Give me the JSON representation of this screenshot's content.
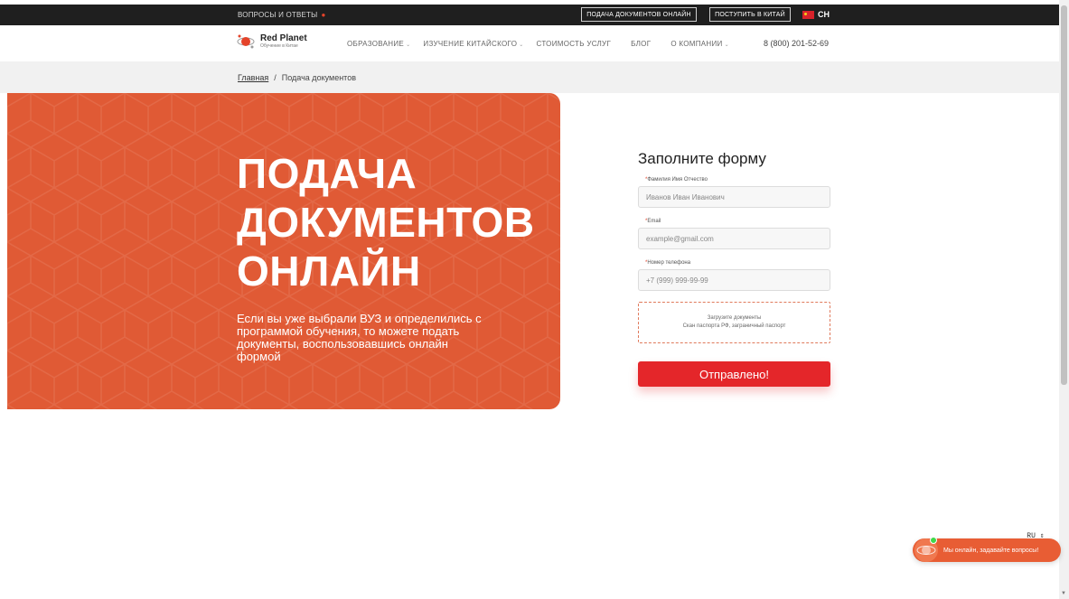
{
  "topbar": {
    "faq_label": "ВОПРОСЫ И ОТВЕТЫ",
    "submit_docs_button": "ПОДАЧА ДОКУМЕНТОВ ОНЛАЙН",
    "apply_china_button": "ПОСТУПИТЬ В КИТАЙ",
    "language": "CH"
  },
  "header": {
    "logo_name": "Red Planet",
    "logo_tagline": "Обучение в Китае",
    "nav": [
      {
        "label": "ОБРАЗОВАНИЕ",
        "dropdown": true
      },
      {
        "label": "ИЗУЧЕНИЕ КИТАЙСКОГО",
        "dropdown": true
      },
      {
        "label": "СТОИМОСТЬ УСЛУГ",
        "dropdown": false
      },
      {
        "label": "БЛОГ",
        "dropdown": false
      },
      {
        "label": "О КОМПАНИИ",
        "dropdown": true
      }
    ],
    "phone": "8 (800) 201-52-69"
  },
  "breadcrumb": {
    "home": "Главная",
    "separator": "/",
    "current": "Подача документов"
  },
  "hero": {
    "title_line1": "ПОДАЧА",
    "title_line2": "ДОКУМЕНТОВ",
    "title_line3": "ОНЛАЙН",
    "lead": "Если вы уже выбрали ВУЗ и определились с программой обучения, то можете подать документы, воспользовавшись онлайн формой"
  },
  "form": {
    "title": "Заполните форму",
    "fields": [
      {
        "label": "Фамилия Имя Отчество",
        "placeholder": "Иванов Иван Иванович"
      },
      {
        "label": "Email",
        "placeholder": "example@gmail.com"
      },
      {
        "label": "Номер телефона",
        "placeholder": "+7 (999) 999-99-99"
      }
    ],
    "upload_line1": "Загрузите документы",
    "upload_line2": "Скан паспорта РФ, заграничный паспорт",
    "submit_label": "Отправлено!"
  },
  "widgets": {
    "language_selector": "RU",
    "chat_text": "Мы онлайн, задавайте вопросы!"
  },
  "colors": {
    "accent": "#e05a35",
    "button": "#e4262a",
    "topbar": "#1f1f1f"
  }
}
